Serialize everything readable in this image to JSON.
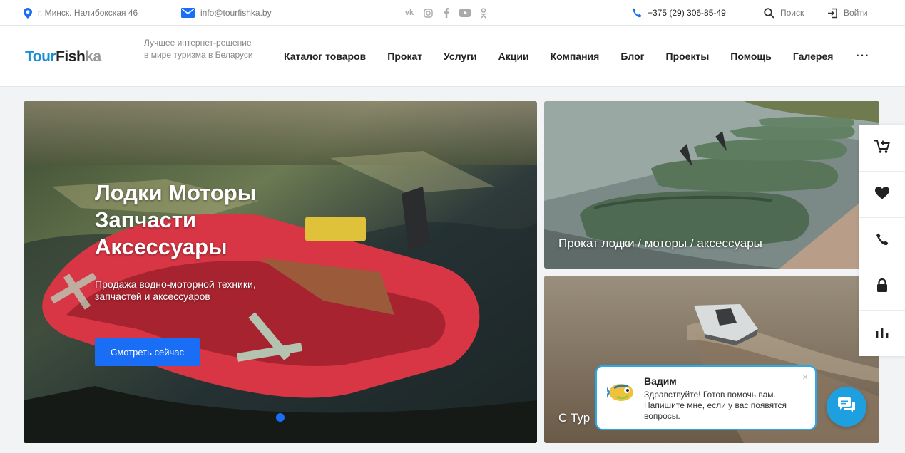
{
  "topbar": {
    "address": "г. Минск. Налибокская 46",
    "email": "info@tourfishka.by",
    "social": [
      "vk-icon",
      "instagram-icon",
      "facebook-icon",
      "youtube-icon",
      "odnoklassniki-icon"
    ],
    "phone": "+375 (29) 306-85-49",
    "search_label": "Поиск",
    "login_label": "Войти"
  },
  "header": {
    "logo_part1": "Tour",
    "logo_part2": "Fish",
    "logo_part3": "ka",
    "tagline": "Лучшее интернет-решение в мире туризма в Беларуси",
    "nav": [
      "Каталог товаров",
      "Прокат",
      "Услуги",
      "Акции",
      "Компания",
      "Блог",
      "Проекты",
      "Помощь",
      "Галерея"
    ],
    "more": "···"
  },
  "hero": {
    "title_line1": "Лодки Моторы",
    "title_line2": "Запчасти",
    "title_line3": "Аксессуары",
    "subtitle": "Продажа водно-моторной техники, запчастей и аксессуаров",
    "button": "Смотреть сейчас"
  },
  "cards": {
    "card1_caption": "Прокат лодки / моторы / аксессуары",
    "card2_caption": "С Тур"
  },
  "chat": {
    "name": "Вадим",
    "message": "Здравствуйте! Готов помочь вам. Напишите мне, если у вас появятся вопросы.",
    "close": "×"
  },
  "colors": {
    "accent": "#1a6ef5",
    "brand_blue": "#1a8fd4",
    "chat_blue": "#1e9fe0"
  }
}
